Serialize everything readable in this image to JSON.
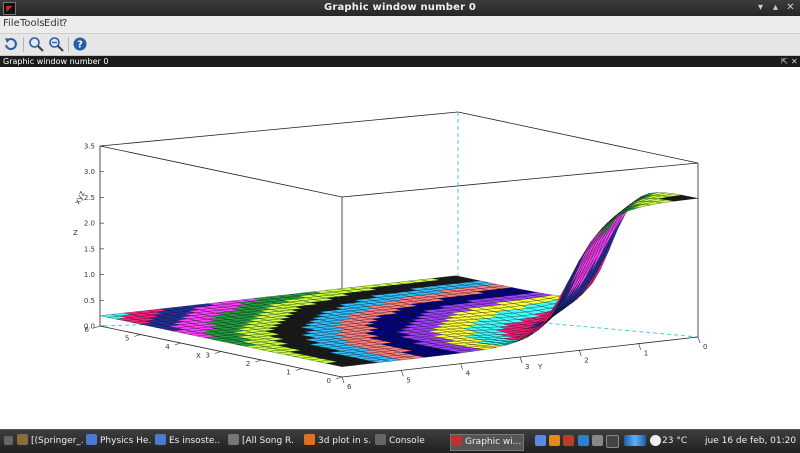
{
  "window": {
    "title": "Graphic window number 0"
  },
  "menu": {
    "items": [
      "File",
      "Tools",
      "Edit",
      "?"
    ]
  },
  "toolbar": {
    "buttons": [
      {
        "name": "rotate-icon"
      },
      {
        "name": "zoom-icon"
      },
      {
        "name": "unzoom-icon"
      },
      {
        "name": "help-icon"
      }
    ]
  },
  "dock": {
    "label": "Graphic window number 0",
    "undock_glyph": "⇱",
    "close_glyph": "✕"
  },
  "plot": {
    "axis_z": {
      "label": "Z",
      "ticks": [
        "0.0",
        "0.5",
        "1.0",
        "1.5",
        "2.0",
        "2.5",
        "3.0",
        "3.5"
      ]
    },
    "axis_x": {
      "label": "X",
      "ticks": [
        "0",
        "1",
        "2",
        "3",
        "4",
        "5",
        "6"
      ]
    },
    "axis_y": {
      "label": "Y",
      "ticks": [
        "0",
        "1",
        "2",
        "3",
        "4",
        "5",
        "6"
      ]
    }
  },
  "chart_data": {
    "type": "surface3d",
    "xlabel": "X",
    "ylabel": "Y",
    "zlabel": "Z",
    "xlim": [
      0,
      6
    ],
    "ylim": [
      0,
      6
    ],
    "zlim": [
      0,
      3.5
    ],
    "description_values": {
      "z_flat_region": 0.2,
      "z_max_corner": 2.7
    }
  },
  "taskbar": {
    "tasks": [
      {
        "label": "[(Springer_...",
        "color": "#8a6d3b"
      },
      {
        "label": "Physics He...",
        "color": "#4a7bd0"
      },
      {
        "label": "Es insoste...",
        "color": "#4a7bd0"
      },
      {
        "label": "[All Song R...",
        "color": "#777777"
      },
      {
        "label": "3d plot in s...",
        "color": "#e07020"
      },
      {
        "label": "Console",
        "color": "#666666"
      },
      {
        "label": "Graphic wi...",
        "color": "#c03030",
        "active": true
      }
    ],
    "temperature": "23 °C",
    "datetime": "jue 16 de feb, 01:20"
  }
}
